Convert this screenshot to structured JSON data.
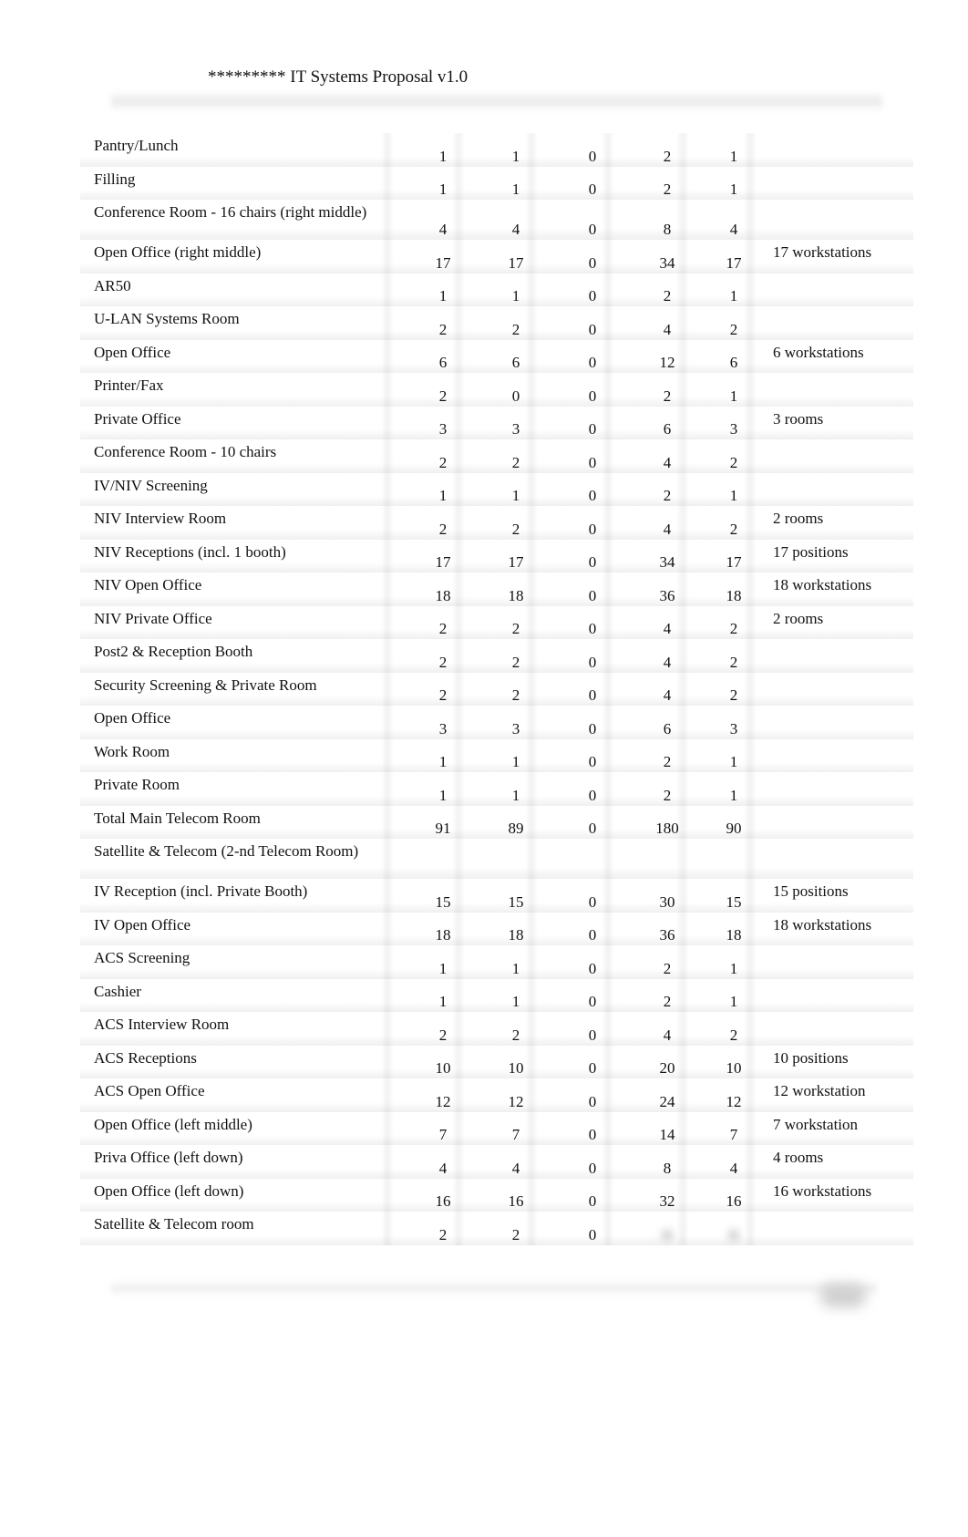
{
  "document": {
    "title": "********* IT Systems Proposal v1.0"
  },
  "table": {
    "rows": [
      {
        "name": "Pantry/Lunch",
        "v": [
          "1",
          "1",
          "0",
          "2",
          "1"
        ],
        "note": ""
      },
      {
        "name": "Filling",
        "v": [
          "1",
          "1",
          "0",
          "2",
          "1"
        ],
        "note": ""
      },
      {
        "name": "Conference Room - 16 chairs (right middle)",
        "v": [
          "4",
          "4",
          "0",
          "8",
          "4"
        ],
        "note": ""
      },
      {
        "name": "Open Office (right middle)",
        "v": [
          "17",
          "17",
          "0",
          "34",
          "17"
        ],
        "note": "17 workstations"
      },
      {
        "name": "AR50",
        "v": [
          "1",
          "1",
          "0",
          "2",
          "1"
        ],
        "note": ""
      },
      {
        "name": "U-LAN Systems Room",
        "v": [
          "2",
          "2",
          "0",
          "4",
          "2"
        ],
        "note": ""
      },
      {
        "name": "Open Office",
        "v": [
          "6",
          "6",
          "0",
          "12",
          "6"
        ],
        "note": "6 workstations"
      },
      {
        "name": "Printer/Fax",
        "v": [
          "2",
          "0",
          "0",
          "2",
          "1"
        ],
        "note": ""
      },
      {
        "name": "Private Office",
        "v": [
          "3",
          "3",
          "0",
          "6",
          "3"
        ],
        "note": "3 rooms"
      },
      {
        "name": "Conference Room - 10 chairs",
        "v": [
          "2",
          "2",
          "0",
          "4",
          "2"
        ],
        "note": ""
      },
      {
        "name": "IV/NIV Screening",
        "v": [
          "1",
          "1",
          "0",
          "2",
          "1"
        ],
        "note": ""
      },
      {
        "name": "NIV Interview Room",
        "v": [
          "2",
          "2",
          "0",
          "4",
          "2"
        ],
        "note": "2 rooms"
      },
      {
        "name": "NIV Receptions (incl. 1 booth)",
        "v": [
          "17",
          "17",
          "0",
          "34",
          "17"
        ],
        "note": "17 positions"
      },
      {
        "name": "NIV Open Office",
        "v": [
          "18",
          "18",
          "0",
          "36",
          "18"
        ],
        "note": "18 workstations"
      },
      {
        "name": "NIV Private Office",
        "v": [
          "2",
          "2",
          "0",
          "4",
          "2"
        ],
        "note": "2 rooms"
      },
      {
        "name": "Post2 & Reception Booth",
        "v": [
          "2",
          "2",
          "0",
          "4",
          "2"
        ],
        "note": ""
      },
      {
        "name": "Security Screening & Private Room",
        "v": [
          "2",
          "2",
          "0",
          "4",
          "2"
        ],
        "note": ""
      },
      {
        "name": "Open Office",
        "v": [
          "3",
          "3",
          "0",
          "6",
          "3"
        ],
        "note": ""
      },
      {
        "name": "Work Room",
        "v": [
          "1",
          "1",
          "0",
          "2",
          "1"
        ],
        "note": ""
      },
      {
        "name": "Private Room",
        "v": [
          "1",
          "1",
          "0",
          "2",
          "1"
        ],
        "note": ""
      },
      {
        "name": "Total Main Telecom Room",
        "v": [
          "91",
          "89",
          "0",
          "180",
          "90"
        ],
        "note": ""
      },
      {
        "name": "Satellite & Telecom (2-nd Telecom Room)",
        "v": [
          "",
          "",
          "",
          "",
          ""
        ],
        "note": ""
      },
      {
        "name": "IV Reception (incl. Private Booth)",
        "v": [
          "15",
          "15",
          "0",
          "30",
          "15"
        ],
        "note": "15 positions"
      },
      {
        "name": "IV Open Office",
        "v": [
          "18",
          "18",
          "0",
          "36",
          "18"
        ],
        "note": "18 workstations"
      },
      {
        "name": "ACS Screening",
        "v": [
          "1",
          "1",
          "0",
          "2",
          "1"
        ],
        "note": ""
      },
      {
        "name": "Cashier",
        "v": [
          "1",
          "1",
          "0",
          "2",
          "1"
        ],
        "note": ""
      },
      {
        "name": "ACS Interview Room",
        "v": [
          "2",
          "2",
          "0",
          "4",
          "2"
        ],
        "note": ""
      },
      {
        "name": "ACS Receptions",
        "v": [
          "10",
          "10",
          "0",
          "20",
          "10"
        ],
        "note": "10 positions"
      },
      {
        "name": "ACS Open Office",
        "v": [
          "12",
          "12",
          "0",
          "24",
          "12"
        ],
        "note": "12 workstation"
      },
      {
        "name": "Open Office (left middle)",
        "v": [
          "7",
          "7",
          "0",
          "14",
          "7"
        ],
        "note": "7 workstation"
      },
      {
        "name": "Priva Office (left down)",
        "v": [
          "4",
          "4",
          "0",
          "8",
          "4"
        ],
        "note": "4 rooms"
      },
      {
        "name": "Open Office (left down)",
        "v": [
          "16",
          "16",
          "0",
          "32",
          "16"
        ],
        "note": "16 workstations"
      },
      {
        "name": "Satellite & Telecom room",
        "v": [
          "2",
          "2",
          "0",
          "",
          ""
        ],
        "note": ""
      }
    ]
  }
}
